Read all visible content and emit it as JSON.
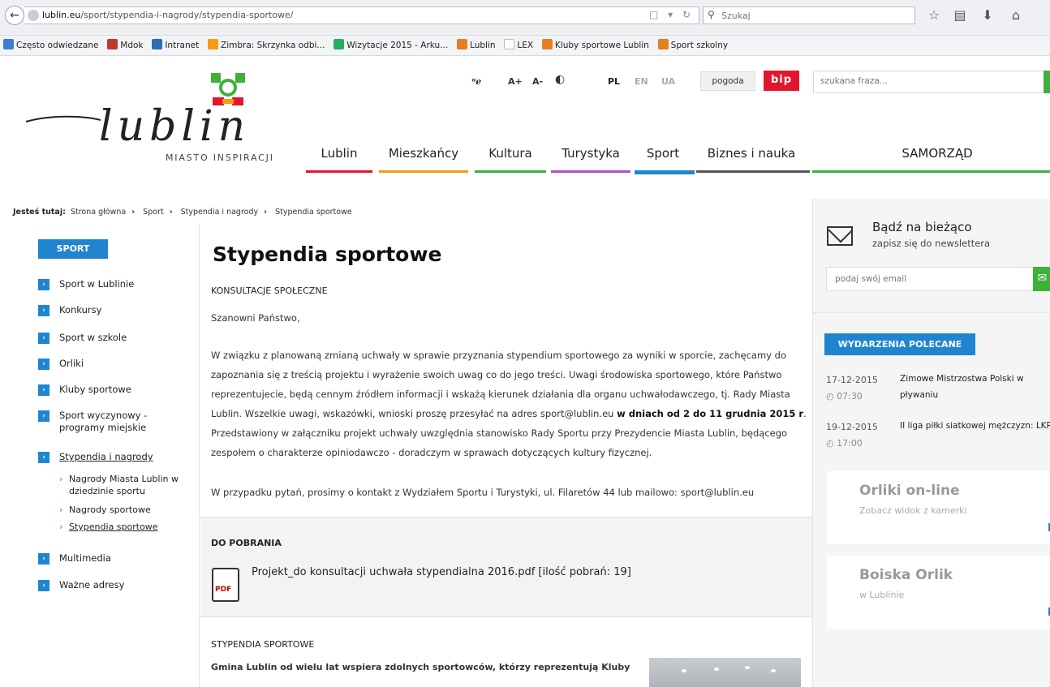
{
  "browser": {
    "url_domain": "lublin.eu",
    "url_path": "/sport/stypendia-i-nagrody/stypendia-sportowe/",
    "search_placeholder": "Szukaj",
    "bookmarks": [
      {
        "label": "Często odwiedzane",
        "color": "#3b7dd8"
      },
      {
        "label": "Mdok",
        "color": "#c0392b"
      },
      {
        "label": "Intranet",
        "color": "#2e6db4"
      },
      {
        "label": "Zimbra: Skrzynka odbi...",
        "color": "#f39c12"
      },
      {
        "label": "Wizytacje 2015 - Arku...",
        "color": "#27ae60"
      },
      {
        "label": "Lublin",
        "color": "#e67e22"
      },
      {
        "label": "LEX",
        "color": "#bbbbbb"
      },
      {
        "label": "Kluby sportowe Lublin",
        "color": "#e67e22"
      },
      {
        "label": "Sport szkolny",
        "color": "#e67e22"
      }
    ]
  },
  "header": {
    "logo_word": "lublin",
    "tagline": "MIASTO INSPIRACJI",
    "a11y": [
      "A+",
      "A-"
    ],
    "langs": [
      "PL",
      "EN",
      "UA"
    ],
    "weather": "pogoda",
    "bip": "bip",
    "search_placeholder": "szukana fraza...",
    "nav": [
      {
        "label": "Lublin",
        "color": "#e3162d"
      },
      {
        "label": "Mieszkańcy",
        "color": "#f39c12"
      },
      {
        "label": "Kultura",
        "color": "#3fb13a"
      },
      {
        "label": "Turystyka",
        "color": "#b04fc9"
      },
      {
        "label": "Sport",
        "color": "#1f85d0"
      },
      {
        "label": "Biznes i nauka",
        "color": "#555555"
      },
      {
        "label": "SAMORZĄD",
        "color": "#3fb13a"
      }
    ]
  },
  "breadcrumb": {
    "label": "Jesteś tutaj:",
    "items": [
      "Strona główna",
      "Sport",
      "Stypendia i nagrody",
      "Stypendia sportowe"
    ]
  },
  "sidebar": {
    "heading": "SPORT",
    "items": [
      "Sport w Lublinie",
      "Konkursy",
      "Sport w szkole",
      "Orliki",
      "Kluby sportowe",
      "Sport wyczynowy - programy miejskie",
      "Stypendia i nagrody",
      "Multimedia",
      "Ważne adresy"
    ],
    "subitems": [
      "Nagrody Miasta Lublin w dziedzinie sportu",
      "Nagrody sportowe",
      "Stypendia sportowe"
    ]
  },
  "main": {
    "title": "Stypendia sportowe",
    "section1": "KONSULTACJE SPOŁECZNE",
    "greeting": "Szanowni Państwo,",
    "para1_a": "W związku z planowaną zmianą uchwały w sprawie przyznania stypendium sportowego za wyniki w sporcie,  zachęcamy do zapoznania się z treścią projektu i wyrażenie swoich uwag co do jego treści. Uwagi środowiska sportowego, które Państwo reprezentujecie, będą cennym źródłem informacji i wskażą kierunek działania dla organu uchwałodawczego, tj. Rady Miasta Lublin. Wszelkie uwagi, wskazówki, wnioski proszę przesyłać na adres sport@lublin.eu",
    "para1_bold": "w dniach od 2 do 11 grudnia 2015 r",
    "para1_b": ". Przedstawiony w załączniku projekt uchwały uwzględnia stanowisko Rady Sportu przy Prezydencie Miasta Lublin, będącego zespołem o charakterze opiniodawczo - doradczym w sprawach dotyczących kultury fizycznej.",
    "para2": "W przypadku pytań, prosimy o kontakt z Wydziałem Sportu i Turystyki, ul. Filaretów 44 lub mailowo: sport@lublin.eu",
    "downloads_title": "DO POBRANIA",
    "pdf_label": "PDF",
    "download_link": "Projekt_do konsultacji uchwała stypendialna 2016.pdf [ilość pobrań: 19]",
    "section2": "STYPENDIA SPORTOWE",
    "para3": "Gmina Lublin od wielu lat wspiera zdolnych sportowców, którzy reprezentują Kluby"
  },
  "right": {
    "nl_title": "Bądź na bieżąco",
    "nl_sub": "zapisz się do newslettera",
    "nl_placeholder": "podaj swój email",
    "events_head": "WYDARZENIA POLECANE",
    "events": [
      {
        "date": "17-12-2015",
        "time": "07:30",
        "title": "Zimowe Mistrzostwa Polski w pływaniu"
      },
      {
        "date": "19-12-2015",
        "time": "17:00",
        "title": "II liga piłki siatkowej mężczyzn: LKPS Lublin - KS Błękitni Ropczyce"
      }
    ],
    "box1_title": "Orliki on-line",
    "box1_sub": "Zobacz widok z kamerki",
    "box2_title": "Boiska Orlik",
    "box2_sub": "w Lublinie"
  }
}
